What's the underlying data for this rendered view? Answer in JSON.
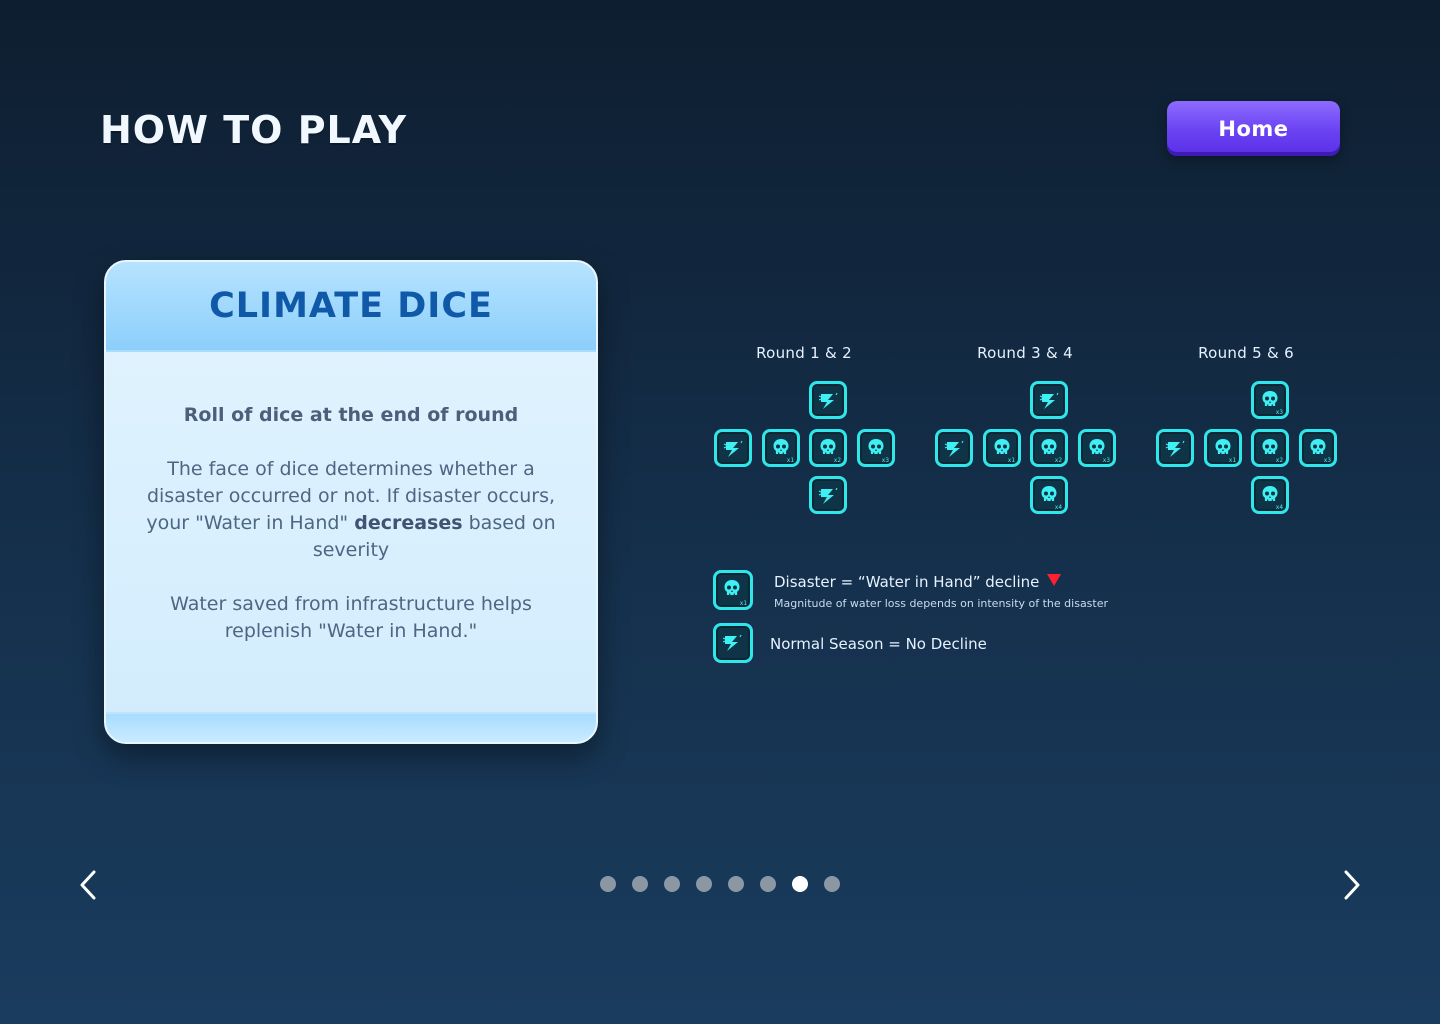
{
  "page": {
    "title": "HOW TO PLAY"
  },
  "header": {
    "home_label": "Home"
  },
  "card": {
    "title": "CLIMATE DICE",
    "subtitle": "Roll of dice at the end of round",
    "para1": "The face of dice determines whether a disaster occurred or not.  If disaster occurs, your \"Water in Hand\"",
    "para1_bold": "decreases",
    "para1_end": "based on severity",
    "para2": "Water saved from infrastructure helps replenish \"Water in Hand.\""
  },
  "rounds": [
    {
      "label": "Round 1 & 2",
      "faces": {
        "top": "lightning",
        "left": "lightning",
        "center_left": "skull",
        "center_left_mult": "x1",
        "center": "skull",
        "center_mult": "x2",
        "right": "skull",
        "right_mult": "x3",
        "bottom": "lightning"
      }
    },
    {
      "label": "Round 3 & 4",
      "faces": {
        "top": "lightning",
        "left": "lightning",
        "center_left": "skull",
        "center_left_mult": "x1",
        "center": "skull",
        "center_mult": "x2",
        "right": "skull",
        "right_mult": "x3",
        "bottom": "skull",
        "bottom_mult": "x4"
      }
    },
    {
      "label": "Round 5 & 6",
      "faces": {
        "top": "skull",
        "top_mult": "x3",
        "left": "lightning",
        "center_left": "skull",
        "center_left_mult": "x1",
        "center": "skull",
        "center_mult": "x2",
        "right": "skull",
        "right_mult": "x3",
        "bottom": "skull",
        "bottom_mult": "x4"
      }
    }
  ],
  "legend": {
    "disaster_title": "Disaster = “Water in Hand” decline",
    "disaster_note": "Magnitude of water loss depends on intensity of the disaster",
    "disaster_mult": "x1",
    "normal_title": "Normal Season = No Decline"
  },
  "pagination": {
    "total": 8,
    "current": 7
  },
  "icons": {
    "prev": "chevron-left-icon",
    "next": "chevron-right-icon",
    "disaster": "skull-icon",
    "normal": "lightning-icon"
  },
  "colors": {
    "accent": "#2fe6ea",
    "home_button": "#6a42f2",
    "card_title": "#1059a8",
    "decline_arrow": "#ff2030"
  }
}
